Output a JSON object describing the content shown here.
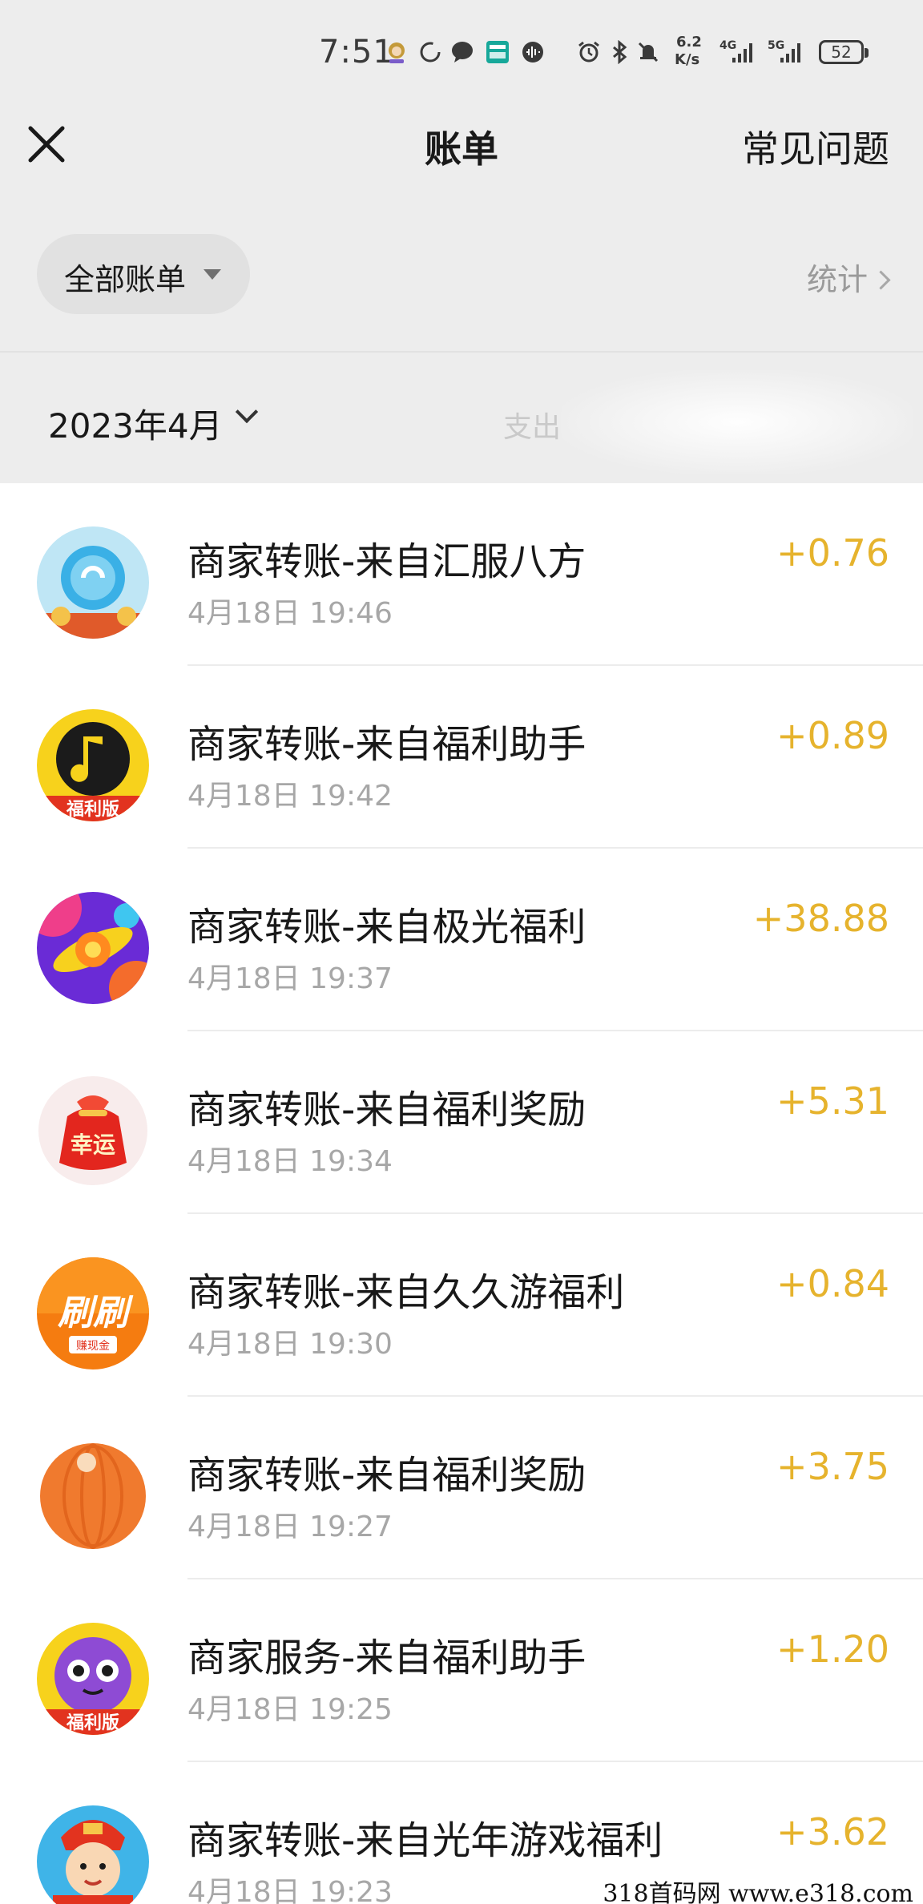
{
  "status_bar": {
    "time": "7:51",
    "speed_value": "6.2",
    "speed_unit": "K/s",
    "net1": "4G",
    "net2": "5G",
    "battery": "52"
  },
  "nav": {
    "title": "账单",
    "faq": "常见问题"
  },
  "filter": {
    "label": "全部账单",
    "stats": "统计"
  },
  "month": {
    "label": "2023年4月",
    "summary": "支出"
  },
  "colors": {
    "amount": "#e6b32d",
    "background_top": "#ededed"
  },
  "bills": [
    {
      "title": "商家转账-来自汇服八方",
      "time": "4月18日 19:46",
      "amount": "+0.76",
      "icon": "huifu-bafang-app-icon"
    },
    {
      "title": "商家转账-来自福利助手",
      "time": "4月18日 19:42",
      "amount": "+0.89",
      "icon": "music-note-welfare-app-icon"
    },
    {
      "title": "商家转账-来自极光福利",
      "time": "4月18日 19:37",
      "amount": "+38.88",
      "icon": "planet-app-icon"
    },
    {
      "title": "商家转账-来自福利奖励",
      "time": "4月18日 19:34",
      "amount": "+5.31",
      "icon": "lucky-bag-app-icon"
    },
    {
      "title": "商家转账-来自久久游福利",
      "time": "4月18日 19:30",
      "amount": "+0.84",
      "icon": "shuashua-app-icon"
    },
    {
      "title": "商家转账-来自福利奖励",
      "time": "4月18日 19:27",
      "amount": "+3.75",
      "icon": "orange-lantern-app-icon"
    },
    {
      "title": "商家服务-来自福利助手",
      "time": "4月18日 19:25",
      "amount": "+1.20",
      "icon": "purple-creature-welfare-app-icon"
    },
    {
      "title": "商家转账-来自光年游戏福利",
      "time": "4月18日 19:23",
      "amount": "+3.62",
      "icon": "god-of-wealth-app-icon"
    }
  ],
  "avatar_labels": {
    "welfare_badge": "福利版",
    "lucky": "幸运",
    "shuashua": "刷刷",
    "shuashua_sub": "赚现金"
  },
  "watermark": "318首码网  www.e318.com"
}
